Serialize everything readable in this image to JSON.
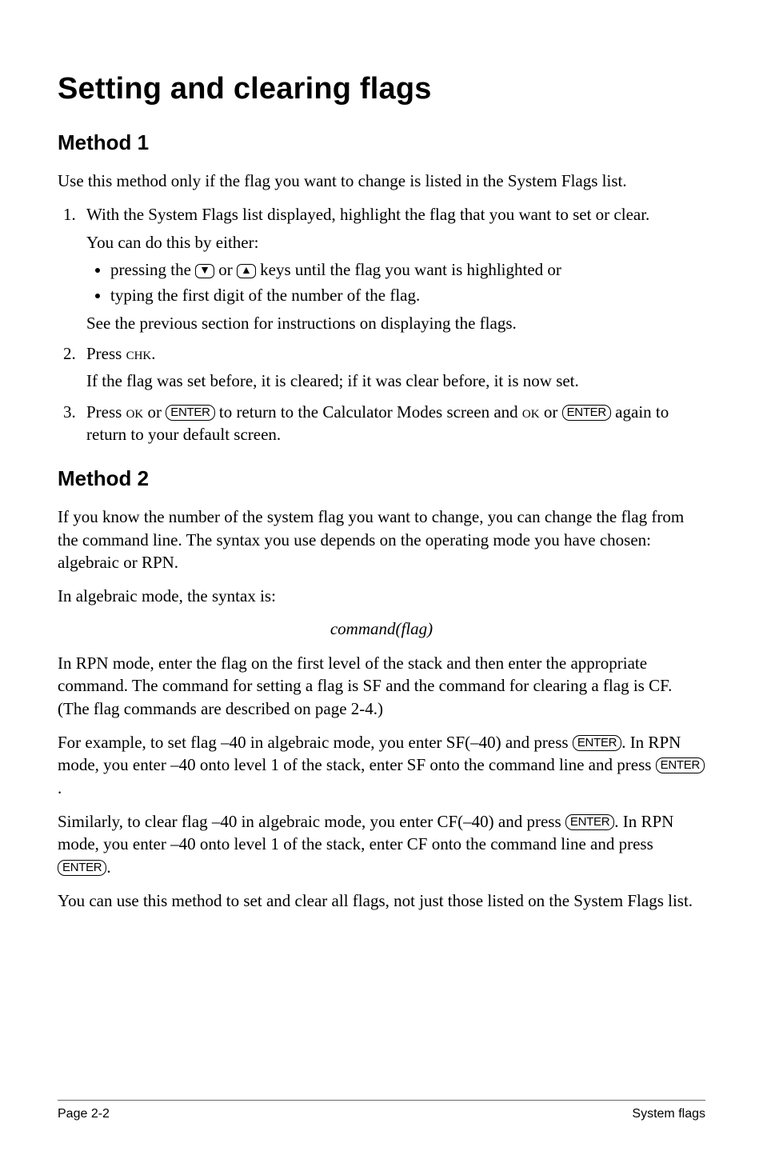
{
  "title": "Setting and clearing flags",
  "method1": {
    "heading": "Method 1",
    "intro": "Use this method only if the flag you want to change is listed in the System Flags list.",
    "steps": {
      "s1a": "With the System Flags list displayed, highlight the flag that you want to set or clear.",
      "s1b": "You can do this by either:",
      "b1_pre": "pressing the ",
      "b1_mid": " or ",
      "b1_post": " keys until the flag you want is highlighted or",
      "b2": "typing the first digit of the number of the flag.",
      "s1c": "See the previous section for instructions on displaying the flags.",
      "s2a_pre": "Press ",
      "s2a_chk": "chk",
      "s2a_post": ".",
      "s2b": "If the flag was set before, it is cleared; if it was clear before, it is now set.",
      "s3_pre": "Press ",
      "s3_ok": "ok",
      "s3_or1": " or ",
      "s3_mid": " to return to the Calculator Modes screen and ",
      "s3_or2": " or ",
      "s3_post": " again to return to your default screen."
    }
  },
  "keys": {
    "down": "▼",
    "up": "▲",
    "enter": "ENTER"
  },
  "method2": {
    "heading": "Method 2",
    "p1": "If you know the number of the system flag you want to change, you can change the flag from the command line. The syntax you use depends on the operating mode you have chosen: algebraic or RPN.",
    "p2": "In algebraic mode, the syntax is:",
    "syntax": "command(flag)",
    "p3": "In RPN mode, enter the flag on the first level of the stack and then enter the appropriate command. The command for setting a flag is SF and the command for clearing a flag is CF. (The flag commands are described on page 2-4.)",
    "p4_pre": "For example, to set flag –40 in algebraic mode, you enter SF(–40) and press ",
    "p4_mid": ". In RPN mode, you enter –40 onto level 1 of the stack, enter SF onto the command line and press ",
    "p4_post": ".",
    "p5_pre": "Similarly, to clear flag –40 in algebraic mode, you enter CF(–40) and press ",
    "p5_mid": ". In RPN mode, you enter –40 onto level 1 of the stack, enter CF onto the command line and press ",
    "p5_post": ".",
    "p6": "You can use this method to set and clear all flags, not just those listed on the System Flags list."
  },
  "footer": {
    "left": "Page 2-2",
    "right": "System flags"
  }
}
